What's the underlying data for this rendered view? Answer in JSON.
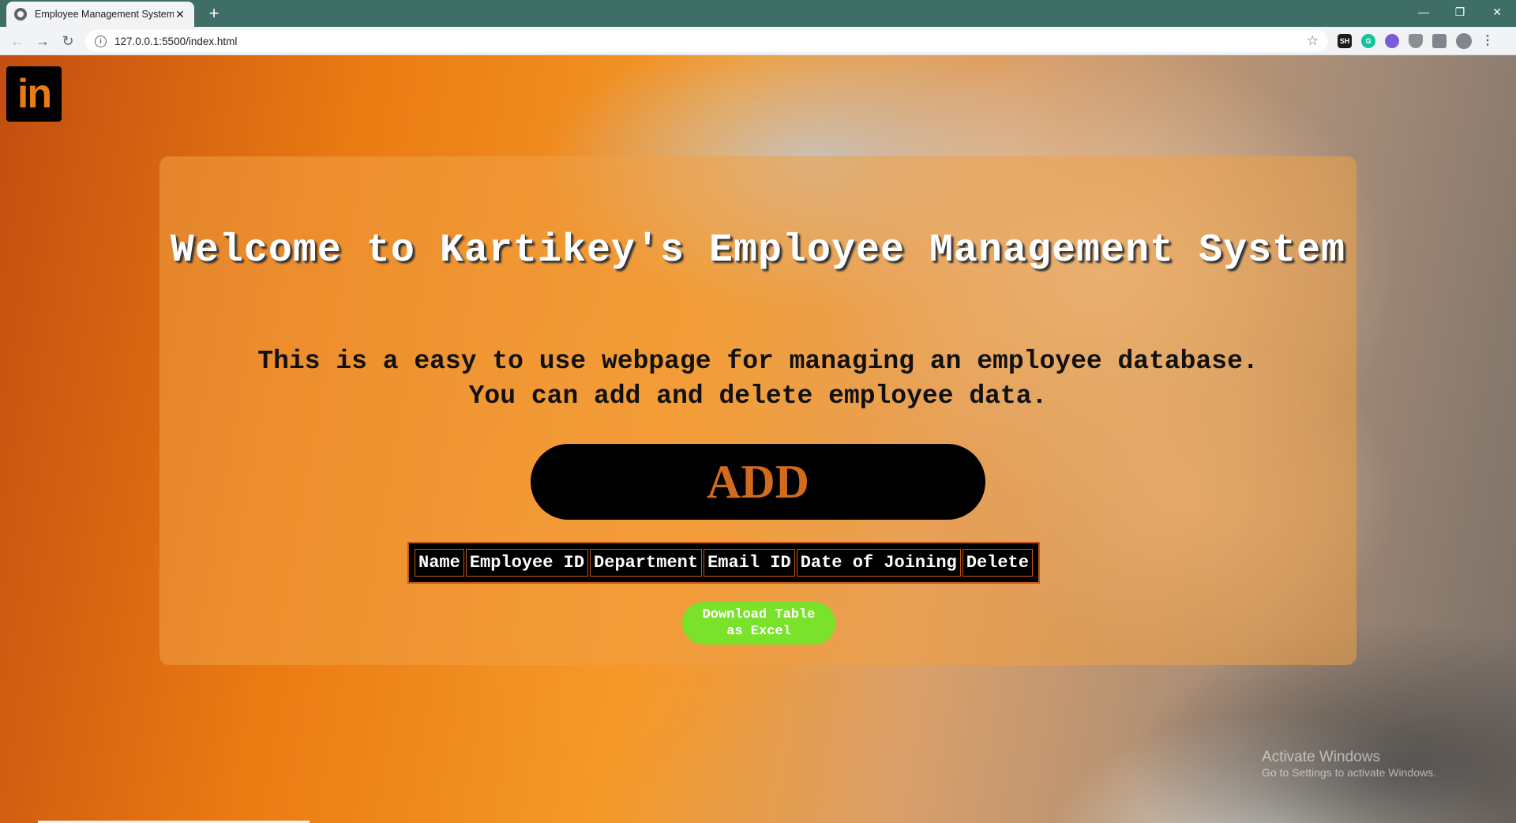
{
  "browser": {
    "tab_title": "Employee Management System",
    "tab_close": "✕",
    "new_tab": "+",
    "url": "127.0.0.1:5500/index.html",
    "window_controls": {
      "minimize": "—",
      "restore": "❐",
      "close": "✕"
    },
    "extensions": {
      "sh_label": "SH",
      "g_label": "G"
    }
  },
  "page": {
    "logo_text": "in",
    "heading": "Welcome to Kartikey's Employee Management System",
    "subtext_line1": "This is a easy to use webpage for managing an employee database.",
    "subtext_line2": "You can add and delete employee data.",
    "add_button": "ADD",
    "table": {
      "columns": [
        "Name",
        "Employee ID",
        "Department",
        "Email ID",
        "Date of Joining",
        "Delete"
      ]
    },
    "download_button": "Download Table as Excel"
  },
  "os_watermark": {
    "title": "Activate Windows",
    "subtitle": "Go to Settings to activate Windows."
  },
  "colors": {
    "accent_orange": "#d16b1e",
    "download_green": "#7be22c",
    "titlebar": "#3f6e66"
  }
}
